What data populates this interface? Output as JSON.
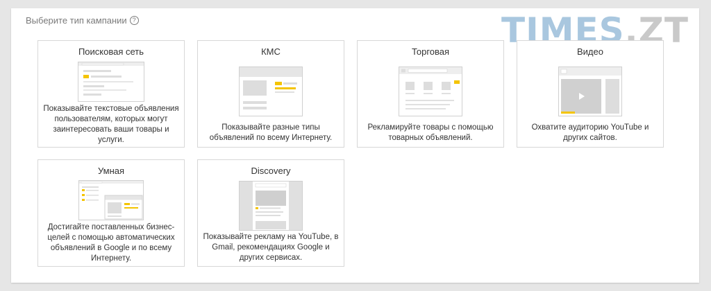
{
  "header": {
    "label": "Выберите тип кампании",
    "help_icon": "?"
  },
  "watermark": {
    "part1": "TIMES",
    "part2": ".ZT"
  },
  "cards": [
    {
      "title": "Поисковая сеть",
      "description": "Показывайте текстовые объявления пользователям, которых могут заинтересовать ваши товары и услуги."
    },
    {
      "title": "КМС",
      "description": "Показывайте разные типы объявлений по всему Интернету."
    },
    {
      "title": "Торговая",
      "description": "Рекламируйте товары с помощью товарных объявлений."
    },
    {
      "title": "Видео",
      "description": "Охватите аудиторию YouTube и других сайтов."
    },
    {
      "title": "Умная",
      "description": "Достигайте поставленных бизнес-целей с помощью автоматических объявлений в Google и по всему Интернету."
    },
    {
      "title": "Discovery",
      "description": "Показывайте рекламу на YouTube, в Gmail, рекомендациях Google и других сервисах."
    }
  ],
  "colors": {
    "accent_yellow": "#f4c400",
    "placeholder_gray": "#dddddd",
    "border": "#d7d7d7",
    "watermark_blue": "#a9c7df",
    "watermark_gray": "#c9c9c9"
  }
}
